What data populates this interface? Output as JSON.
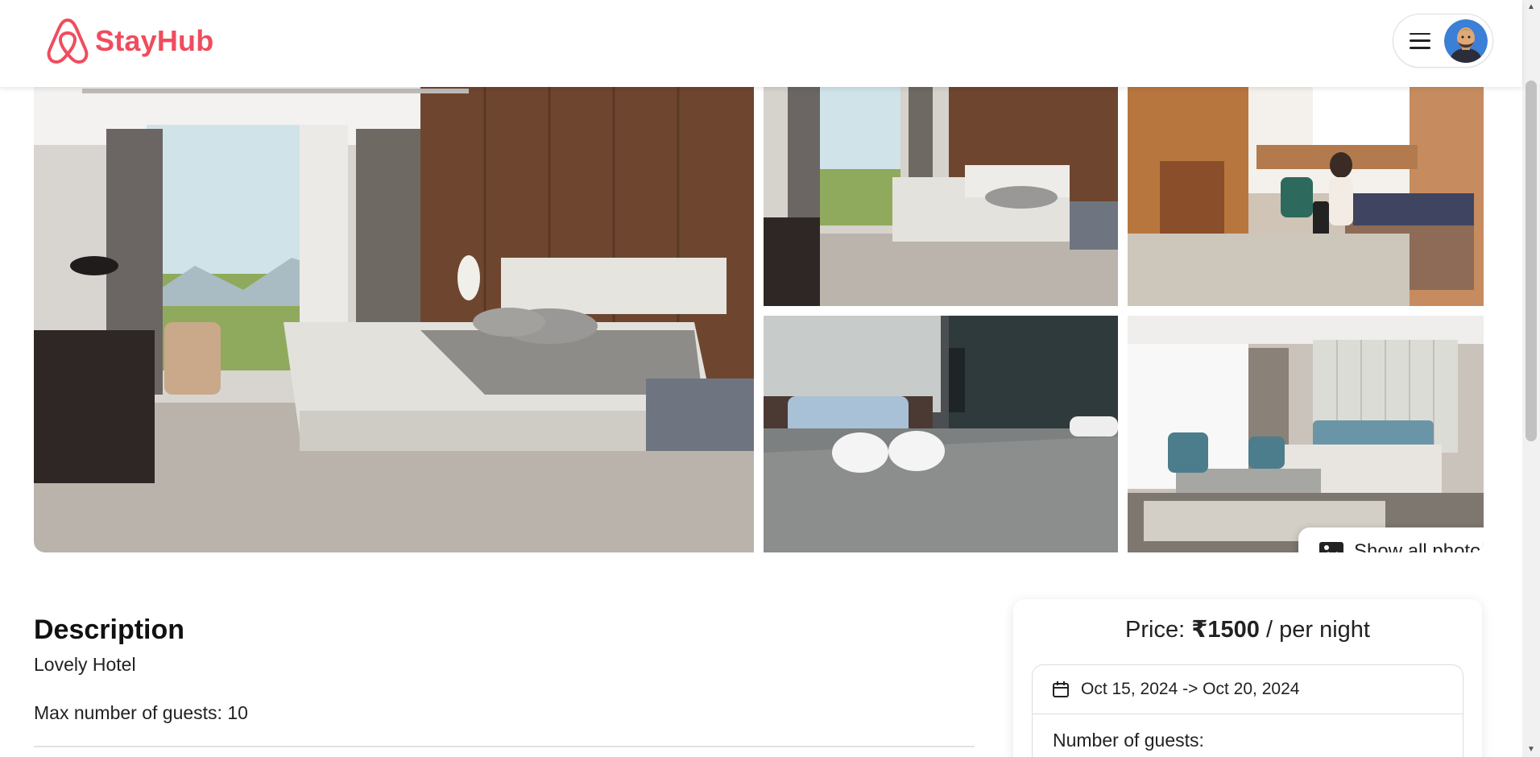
{
  "app": {
    "name": "StayHub",
    "brand_color": "#ef4d5e",
    "logo_icon": "airbnb-style-logo-icon"
  },
  "header": {
    "menu_icon": "hamburger-icon",
    "avatar_icon": "user-avatar"
  },
  "gallery": {
    "photos": [
      {
        "name": "hotel-room-main-photo",
        "subject": "bedroom-with-window"
      },
      {
        "name": "hotel-room-photo-2",
        "subject": "bedroom-with-window"
      },
      {
        "name": "hotel-room-photo-3",
        "subject": "guest-in-room"
      },
      {
        "name": "hotel-room-photo-4",
        "subject": "bed-with-towels"
      },
      {
        "name": "hotel-room-photo-5",
        "subject": "suite-bedroom"
      }
    ],
    "show_all_label": "Show all photos",
    "show_all_icon": "image-icon"
  },
  "listing": {
    "description_heading": "Description",
    "description": "Lovely Hotel",
    "max_guests": "Max number of guests: 10"
  },
  "booking": {
    "price_prefix": "Price: ",
    "price_value": "₹1500",
    "price_suffix": " / per night",
    "date_range": "Oct 15, 2024 -> Oct 20, 2024",
    "calendar_icon": "calendar-icon",
    "guests_label": "Number of guests:"
  }
}
